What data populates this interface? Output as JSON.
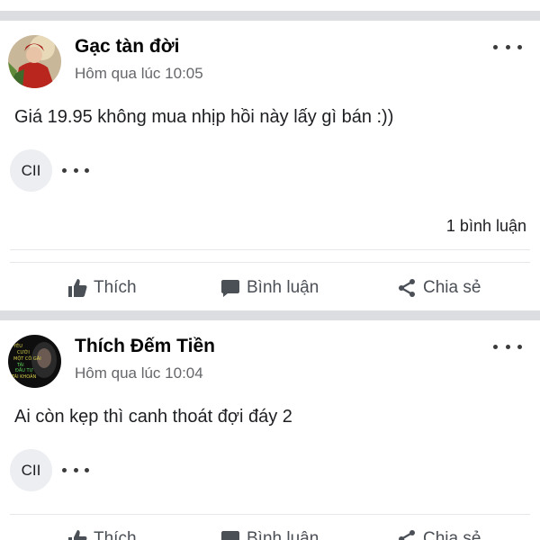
{
  "posts": [
    {
      "author": "Gạc tàn đời",
      "timestamp": "Hôm qua lúc 10:05",
      "text": "Giá 19.95 không mua nhịp hồi này lấy gì bán :))",
      "reaction_chip": "CII",
      "comment_count": "1 bình luận",
      "actions": {
        "like": "Thích",
        "comment": "Bình luận",
        "share": "Chia sẻ"
      }
    },
    {
      "author": "Thích Đếm Tiền",
      "timestamp": "Hôm qua lúc 10:04",
      "text": "Ai còn kẹp thì canh thoát đợi đáy 2",
      "reaction_chip": "CII",
      "avatar_text": [
        "YÊU",
        "CƯỚI",
        "MỘT CÔ GÁI",
        "TÀI",
        "ĐẦU TƯ",
        "TÀI KHOẢN"
      ],
      "actions": {
        "like": "Thích",
        "comment": "Bình luận",
        "share": "Chia sẻ"
      }
    }
  ],
  "colors": {
    "separator": "#dcdde1",
    "secondary_text": "#65676b",
    "action_text": "#4b4f56"
  },
  "icons": [
    "more-dots-icon",
    "thumbs-up-icon",
    "comment-icon",
    "share-icon"
  ]
}
